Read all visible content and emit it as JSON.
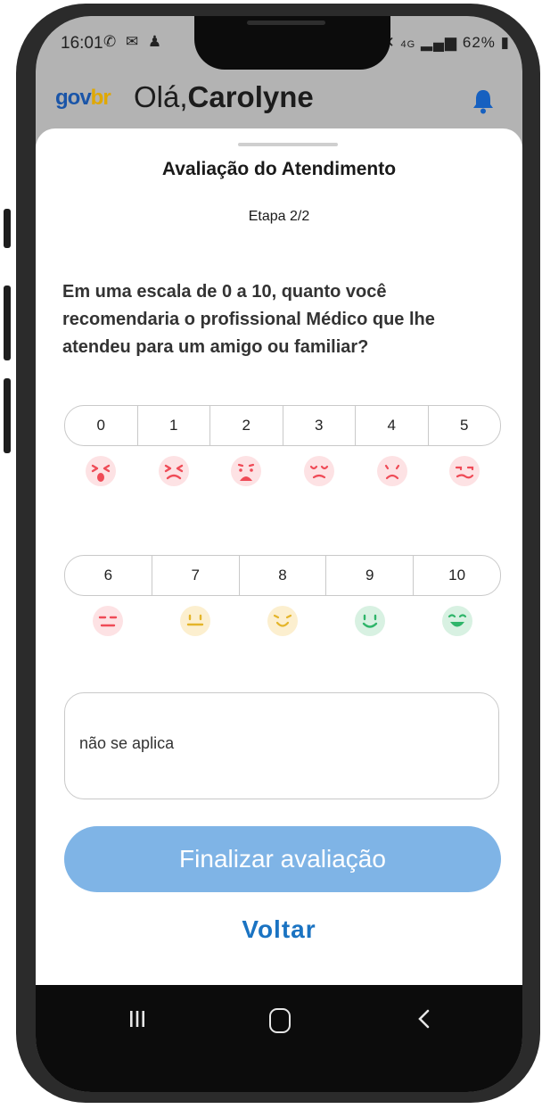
{
  "status_bar": {
    "time": "16:01",
    "battery": "62%",
    "network": "4G"
  },
  "app_bar": {
    "logo_main": "gov",
    "logo_suffix": "br",
    "greeting": "Olá,",
    "user_name": "Carolyne"
  },
  "sheet": {
    "title": "Avaliação do Atendimento",
    "step": "Etapa 2/2",
    "question": "Em uma escala de 0 a 10, quanto você recomendaria o profissional Médico que lhe atendeu para um amigo ou familiar?",
    "scale_row_1": [
      "0",
      "1",
      "2",
      "3",
      "4",
      "5"
    ],
    "scale_row_2": [
      "6",
      "7",
      "8",
      "9",
      "10"
    ],
    "comment_value": "não se aplica",
    "submit_label": "Finalizar avaliação",
    "back_label": "Voltar"
  },
  "colors": {
    "accent": "#1a73c2",
    "button_disabled": "#7fb4e6",
    "red_face": "#ef4b57",
    "yellow_face": "#e4b52a",
    "green_face": "#2fb56a"
  }
}
